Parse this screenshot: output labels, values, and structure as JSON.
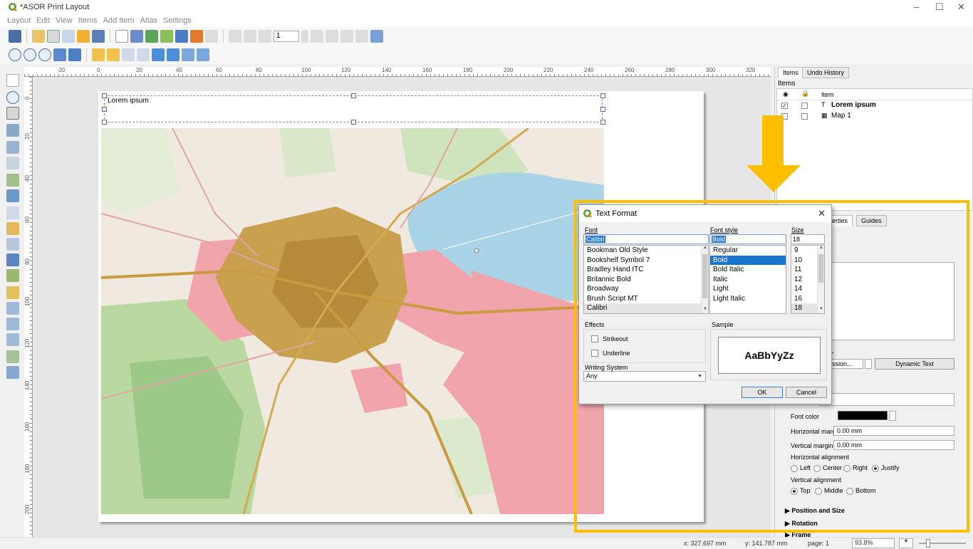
{
  "window": {
    "title": "*ASOR Print Layout"
  },
  "menu": [
    "Layout",
    "Edit",
    "View",
    "Items",
    "Add Item",
    "Atlas",
    "Settings"
  ],
  "toolbar": {
    "page_number": "1"
  },
  "ruler": {
    "h_labels": [
      "-20",
      "0",
      "20",
      "40",
      "60",
      "80",
      "100",
      "120",
      "140",
      "160",
      "180",
      "200",
      "220",
      "240",
      "260",
      "280",
      "300",
      "320"
    ],
    "v_labels": [
      "0",
      "20",
      "40",
      "60",
      "80",
      "100",
      "120",
      "140",
      "160",
      "180",
      "200"
    ]
  },
  "layout": {
    "label_text": "Lorem ipsum"
  },
  "items_panel": {
    "tabs": [
      "Items",
      "Undo History"
    ],
    "title": "Items",
    "col_item": "Item",
    "rows": [
      {
        "name": "Lorem ipsum",
        "visible": true
      },
      {
        "name": "Map 1",
        "visible": false
      }
    ]
  },
  "properties_panel": {
    "tab_label": "perties",
    "guides_tab": "Guides",
    "section_partial": "es",
    "render_html_partial": "ML",
    "insert_expression_partial": "pression...",
    "dynamic_text": "Dynamic Text",
    "font_color_label": "Font color",
    "horizontal_margin_label": "Horizontal margin",
    "horizontal_margin_value": "0.00 mm",
    "vertical_margin_label": "Vertical margin",
    "vertical_margin_value": "0.00 mm",
    "h_align_label": "Horizontal alignment",
    "h_align_options": [
      "Left",
      "Center",
      "Right",
      "Justify"
    ],
    "h_align_selected": "Justify",
    "v_align_label": "Vertical alignment",
    "v_align_options": [
      "Top",
      "Middle",
      "Bottom"
    ],
    "v_align_selected": "Top",
    "sections": [
      "Position and Size",
      "Rotation",
      "Frame"
    ]
  },
  "dialog": {
    "title": "Text Format",
    "font_label": "Font",
    "font_value": "Calibri",
    "font_list": [
      "Bookman Old Style",
      "Bookshelf Symbol 7",
      "Bradley Hand ITC",
      "Britannic Bold",
      "Broadway",
      "Brush Script MT",
      "Calibri"
    ],
    "style_label": "Font style",
    "style_value": "Bold",
    "style_list": [
      "Regular",
      "Bold",
      "Bold Italic",
      "Italic",
      "Light",
      "Light Italic"
    ],
    "size_label": "Size",
    "size_value": "18",
    "size_list": [
      "9",
      "10",
      "11",
      "12",
      "14",
      "16",
      "18"
    ],
    "effects_label": "Effects",
    "strikeout_label": "Strikeout",
    "underline_label": "Underline",
    "sample_label": "Sample",
    "sample_text": "AaBbYyZz",
    "writing_system_label": "Writing System",
    "writing_system_value": "Any",
    "ok": "OK",
    "cancel": "Cancel"
  },
  "status": {
    "x": "x: 327.697 mm",
    "y": "y: 141.787 mm",
    "page": "page: 1",
    "zoom": "93.8%"
  },
  "colors": {
    "highlight": "#ffbf00",
    "selection": "#1874cd",
    "font_color_swatch": "#000000"
  }
}
